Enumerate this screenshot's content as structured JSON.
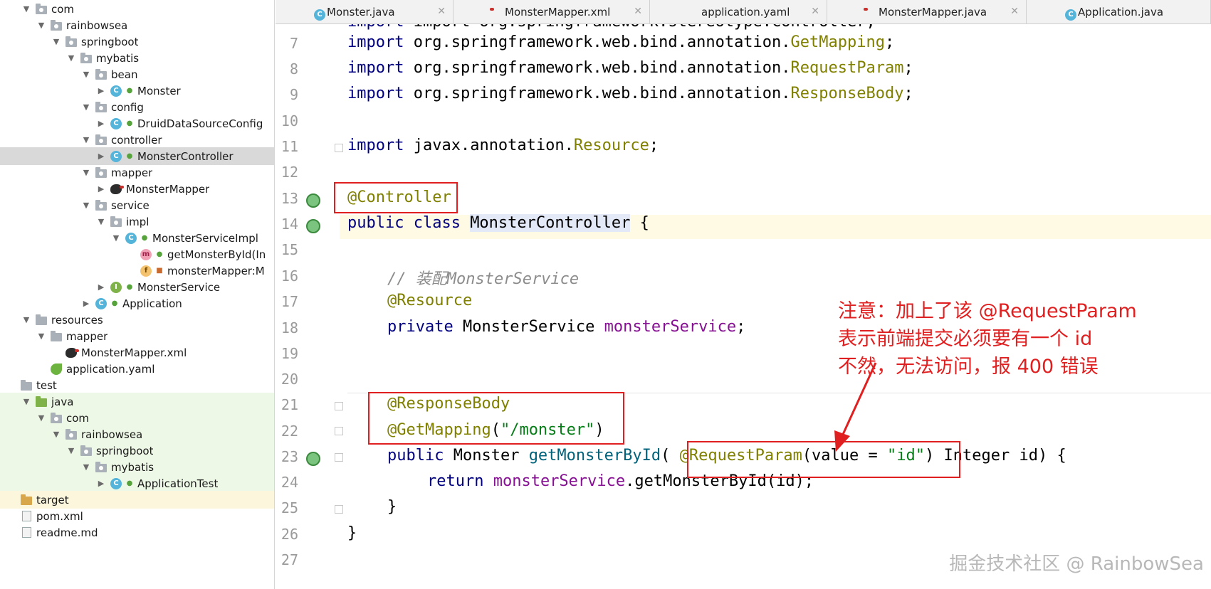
{
  "tree": [
    {
      "label": "com",
      "level": 1,
      "arrow": "down",
      "icon": "package-folder"
    },
    {
      "label": "rainbowsea",
      "level": 2,
      "arrow": "down",
      "icon": "package-folder"
    },
    {
      "label": "springboot",
      "level": 3,
      "arrow": "down",
      "icon": "package-folder"
    },
    {
      "label": "mybatis",
      "level": 4,
      "arrow": "down",
      "icon": "package-folder"
    },
    {
      "label": "bean",
      "level": 5,
      "arrow": "down",
      "icon": "package-folder"
    },
    {
      "label": "Monster",
      "level": 6,
      "arrow": "right",
      "icon": "class-icon"
    },
    {
      "label": "config",
      "level": 5,
      "arrow": "down",
      "icon": "package-folder"
    },
    {
      "label": "DruidDataSourceConfig",
      "level": 6,
      "arrow": "right",
      "icon": "class-icon"
    },
    {
      "label": "controller",
      "level": 5,
      "arrow": "down",
      "icon": "package-folder"
    },
    {
      "label": "MonsterController",
      "level": 6,
      "arrow": "right",
      "icon": "class-icon",
      "state": "selected"
    },
    {
      "label": "mapper",
      "level": 5,
      "arrow": "down",
      "icon": "package-folder"
    },
    {
      "label": "MonsterMapper",
      "level": 6,
      "arrow": "right",
      "icon": "mybatis-icon"
    },
    {
      "label": "service",
      "level": 5,
      "arrow": "down",
      "icon": "package-folder"
    },
    {
      "label": "impl",
      "level": 6,
      "arrow": "down",
      "icon": "package-folder"
    },
    {
      "label": "MonsterServiceImpl",
      "level": 7,
      "arrow": "down",
      "icon": "class-icon"
    },
    {
      "label": "getMonsterById(In",
      "level": 8,
      "arrow": "",
      "icon": "method-icon"
    },
    {
      "label": "monsterMapper:M",
      "level": 8,
      "arrow": "",
      "icon": "field-icon"
    },
    {
      "label": "MonsterService",
      "level": 6,
      "arrow": "right",
      "icon": "interface-icon"
    },
    {
      "label": "Application",
      "level": 5,
      "arrow": "right",
      "icon": "spring-class-icon"
    },
    {
      "label": "resources",
      "level": 1,
      "arrow": "down",
      "icon": "resources-folder"
    },
    {
      "label": "mapper",
      "level": 2,
      "arrow": "down",
      "icon": "folder"
    },
    {
      "label": "MonsterMapper.xml",
      "level": 3,
      "arrow": "",
      "icon": "mybatis-icon"
    },
    {
      "label": "application.yaml",
      "level": 2,
      "arrow": "",
      "icon": "spring-leaf-icon"
    },
    {
      "label": "test",
      "level": 0,
      "arrow": "",
      "icon": "folder"
    },
    {
      "label": "java",
      "level": 1,
      "arrow": "down",
      "icon": "java-test-folder",
      "state": "green"
    },
    {
      "label": "com",
      "level": 2,
      "arrow": "down",
      "icon": "package-folder",
      "state": "green"
    },
    {
      "label": "rainbowsea",
      "level": 3,
      "arrow": "down",
      "icon": "package-folder",
      "state": "green"
    },
    {
      "label": "springboot",
      "level": 4,
      "arrow": "down",
      "icon": "package-folder",
      "state": "green"
    },
    {
      "label": "mybatis",
      "level": 5,
      "arrow": "down",
      "icon": "package-folder",
      "state": "green"
    },
    {
      "label": "ApplicationTest",
      "level": 6,
      "arrow": "right",
      "icon": "spring-class-icon",
      "state": "green"
    },
    {
      "label": "target",
      "level": 0,
      "arrow": "",
      "icon": "target-folder",
      "state": "yellow"
    },
    {
      "label": "pom.xml",
      "level": 0,
      "arrow": "",
      "icon": "file-icon"
    },
    {
      "label": "readme.md",
      "level": 0,
      "arrow": "",
      "icon": "file-icon"
    }
  ],
  "tabs": [
    {
      "label": "Monster.java",
      "icon": "class-icon"
    },
    {
      "label": "MonsterMapper.xml",
      "icon": "mybatis-icon"
    },
    {
      "label": "application.yaml",
      "icon": "spring-leaf-icon"
    },
    {
      "label": "MonsterMapper.java",
      "icon": "mybatis-icon"
    },
    {
      "label": "Application.java",
      "icon": "spring-class-icon"
    }
  ],
  "line_numbers": [
    "7",
    "8",
    "9",
    "10",
    "11",
    "12",
    "13",
    "14",
    "15",
    "16",
    "17",
    "18",
    "19",
    "20",
    "21",
    "22",
    "23",
    "24",
    "25",
    "26",
    "27"
  ],
  "code": {
    "l6": "import org.springframework.stereotype.Controller;",
    "l7_kw": "import",
    "l7_pkg": " org.springframework.web.bind.annotation.",
    "l7_cls": "GetMapping",
    "l7_end": ";",
    "l8_kw": "import",
    "l8_pkg": " org.springframework.web.bind.annotation.",
    "l8_cls": "RequestParam",
    "l8_end": ";",
    "l9_kw": "import",
    "l9_pkg": " org.springframework.web.bind.annotation.",
    "l9_cls": "ResponseBody",
    "l9_end": ";",
    "l11_kw": "import",
    "l11_pkg": " javax.annotation.",
    "l11_cls": "Resource",
    "l11_end": ";",
    "l13": "@Controller",
    "l14_kw": "public class ",
    "l14_name": "MonsterController",
    "l14_end": " {",
    "l16": "// 装配MonsterService",
    "l17": "@Resource",
    "l18_kw": "private ",
    "l18_type": "MonsterService ",
    "l18_field": "monsterService",
    "l18_end": ";",
    "l21": "@ResponseBody",
    "l22_ann": "@GetMapping",
    "l22_open": "(",
    "l22_str": "\"/monster\"",
    "l22_close": ")",
    "l23_kw": "public ",
    "l23_type": "Monster ",
    "l23_method": "getMonsterById",
    "l23_open": "( ",
    "l23_ann": "@RequestParam",
    "l23_p1": "(value = ",
    "l23_str": "\"id\"",
    "l23_p2": ") Integer id) {",
    "l24_kw": "return ",
    "l24_field": "monsterService",
    "l24_call": ".getMonsterById(id);",
    "l25": "}",
    "l26": "}"
  },
  "annotation_note": {
    "line1": "注意：加上了该 @RequestParam",
    "line2": "表示前端提交必须要有一个 id",
    "line3": "不然，无法访问，报 400 错误"
  },
  "watermark": "掘金技术社区 @ RainbowSea",
  "colors": {
    "annotation_red": "#e02020",
    "keyword": "#000080",
    "annotation": "#808000"
  }
}
